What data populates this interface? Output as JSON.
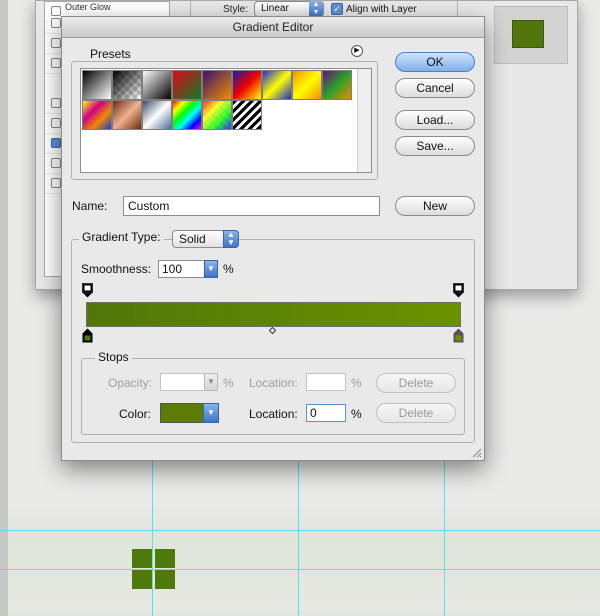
{
  "background_dialog": {
    "list_items": [
      {
        "label": "Outer Glow",
        "checked": false
      },
      {
        "label": "",
        "checked": false
      },
      {
        "label": "",
        "checked": false
      },
      {
        "label": "",
        "checked": false
      },
      {
        "label": "",
        "checked": false
      },
      {
        "label": "",
        "checked": false
      },
      {
        "label": "",
        "checked": true
      },
      {
        "label": "",
        "checked": false
      },
      {
        "label": "",
        "checked": false
      }
    ],
    "style_label": "Style:",
    "style_value": "Linear",
    "align_label": "Align with Layer",
    "preview_color": "#52760c"
  },
  "gradient_editor": {
    "title": "Gradient Editor",
    "presets_label": "Presets",
    "ok_label": "OK",
    "cancel_label": "Cancel",
    "load_label": "Load...",
    "save_label": "Save...",
    "name_label": "Name:",
    "name_value": "Custom",
    "new_label": "New",
    "gradient_type_label": "Gradient Type:",
    "gradient_type_value": "Solid",
    "smoothness_label": "Smoothness:",
    "smoothness_value": "100",
    "smoothness_unit": "%",
    "gradient_colors": [
      "#52760a",
      "#6b9200"
    ],
    "stops": {
      "legend": "Stops",
      "opacity_label": "Opacity:",
      "opacity_value": "",
      "opacity_unit": "%",
      "opacity_location_label": "Location:",
      "opacity_location_value": "",
      "opacity_location_unit": "%",
      "delete_label": "Delete",
      "color_label": "Color:",
      "color_value": "#5b7c08",
      "color_location_label": "Location:",
      "color_location_value": "0",
      "color_location_unit": "%"
    },
    "presets": [
      "black-white",
      "transparent-checker",
      "white-black",
      "red-green",
      "violet-orange",
      "blue-red-yellow",
      "blue-yellow-blue",
      "orange-yellow-orange",
      "violet-green-orange",
      "yellow-violet-orange-blue",
      "copper",
      "chrome",
      "spectrum",
      "transparent-rainbow",
      "transparent-stripes"
    ]
  },
  "canvas": {
    "logo_color": "#4e7a0b",
    "guide_color": "#59e1e6"
  }
}
